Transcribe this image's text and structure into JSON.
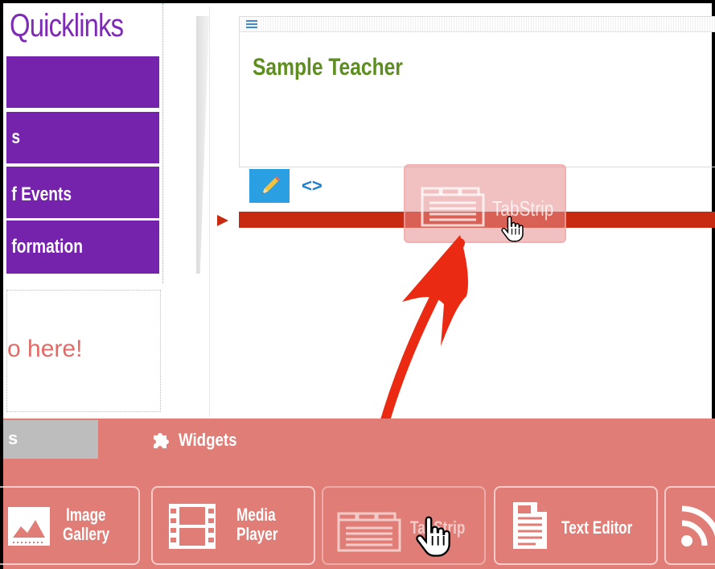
{
  "quicklinks": {
    "title": "Quicklinks",
    "items": [
      "",
      "s",
      "f Events",
      "formation"
    ]
  },
  "drop_zone": {
    "text": "o here!"
  },
  "content_block": {
    "heading": "Sample Teacher"
  },
  "drag_ghost": {
    "label": "TabStrip"
  },
  "panel": {
    "tabs": [
      {
        "label": "s",
        "active": false
      },
      {
        "label": "Widgets",
        "active": true
      }
    ],
    "widgets": [
      {
        "label1": "Image",
        "label2": "Gallery",
        "icon": "image-gallery-icon"
      },
      {
        "label1": "Media",
        "label2": "Player",
        "icon": "film-icon"
      },
      {
        "label1": "TabStrip",
        "label2": "",
        "icon": "tabstrip-icon"
      },
      {
        "label1": "Text Editor",
        "label2": "",
        "icon": "document-icon"
      },
      {
        "label1": "",
        "label2": "",
        "icon": "rss-icon"
      }
    ]
  },
  "colors": {
    "quicklinks_purple": "#7523ad",
    "heading_green": "#5d8e1f",
    "drop_indicator_red": "#c72a10",
    "panel_salmon": "#e07d76",
    "edit_blue": "#2aa0e3"
  }
}
